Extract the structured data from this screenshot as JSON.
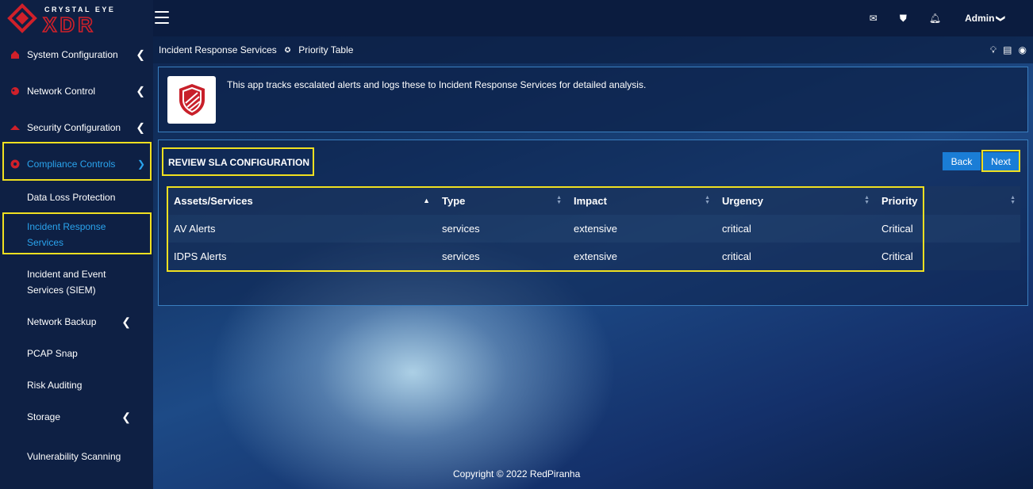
{
  "brand": {
    "top": "CRYSTAL EYE",
    "bottom": "XDR"
  },
  "topbar": {
    "user": "Admin"
  },
  "sidebar": {
    "items": [
      {
        "label": "System Configuration"
      },
      {
        "label": "Network Control"
      },
      {
        "label": "Security Configuration"
      },
      {
        "label": "Compliance Controls"
      }
    ],
    "sub_items": [
      {
        "label": "Data Loss Protection"
      },
      {
        "label": "Incident Response Services"
      },
      {
        "label": "Incident and Event Services (SIEM)"
      },
      {
        "label": "Network Backup"
      },
      {
        "label": "PCAP Snap"
      },
      {
        "label": "Risk Auditing"
      },
      {
        "label": "Storage"
      },
      {
        "label": "Vulnerability Scanning"
      }
    ]
  },
  "breadcrumb": {
    "parent": "Incident Response Services",
    "current": "Priority Table"
  },
  "info": {
    "text": "This app tracks escalated alerts and logs these to Incident Response Services for detailed analysis."
  },
  "panel": {
    "title": "REVIEW SLA CONFIGURATION",
    "back_label": "Back",
    "next_label": "Next",
    "columns": [
      "Assets/Services",
      "Type",
      "Impact",
      "Urgency",
      "Priority"
    ],
    "rows": [
      [
        "AV Alerts",
        "services",
        "extensive",
        "critical",
        "Critical"
      ],
      [
        "IDPS Alerts",
        "services",
        "extensive",
        "critical",
        "Critical"
      ]
    ]
  },
  "footer": {
    "text": "Copyright © 2022 RedPiranha"
  },
  "colors": {
    "accent": "#2aa4ee",
    "highlight": "#f0e020",
    "button": "#1a7dd6",
    "brand_red": "#d0202a"
  }
}
